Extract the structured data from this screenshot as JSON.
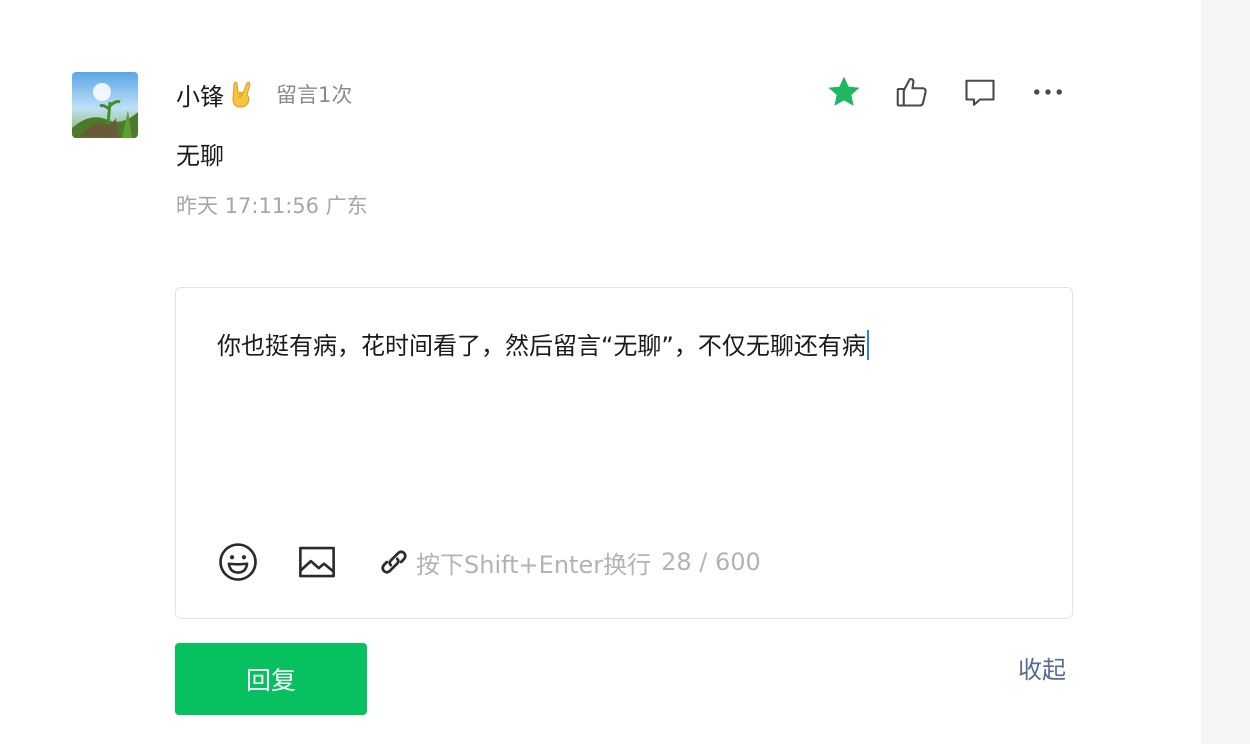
{
  "comment": {
    "username": "小锋",
    "name_emoji": "rock-hand-emoji-icon",
    "comment_count": "留言1次",
    "text": "无聊",
    "meta": "昨天 17:11:56 广东",
    "actions": [
      "star-icon",
      "thumbs-up-icon",
      "comment-icon",
      "more-icon"
    ]
  },
  "reply": {
    "text": "你也挺有病，花时间看了，然后留言“无聊”，不仅无聊还有病",
    "hint": "按下Shift+Enter换行",
    "counter": "28 / 600",
    "submit_label": "回复",
    "collapse_label": "收起"
  },
  "colors": {
    "accent_green": "#07c160",
    "link_blue": "#576b95",
    "star_green": "#1fb862",
    "caret_blue": "#2f7bea"
  }
}
